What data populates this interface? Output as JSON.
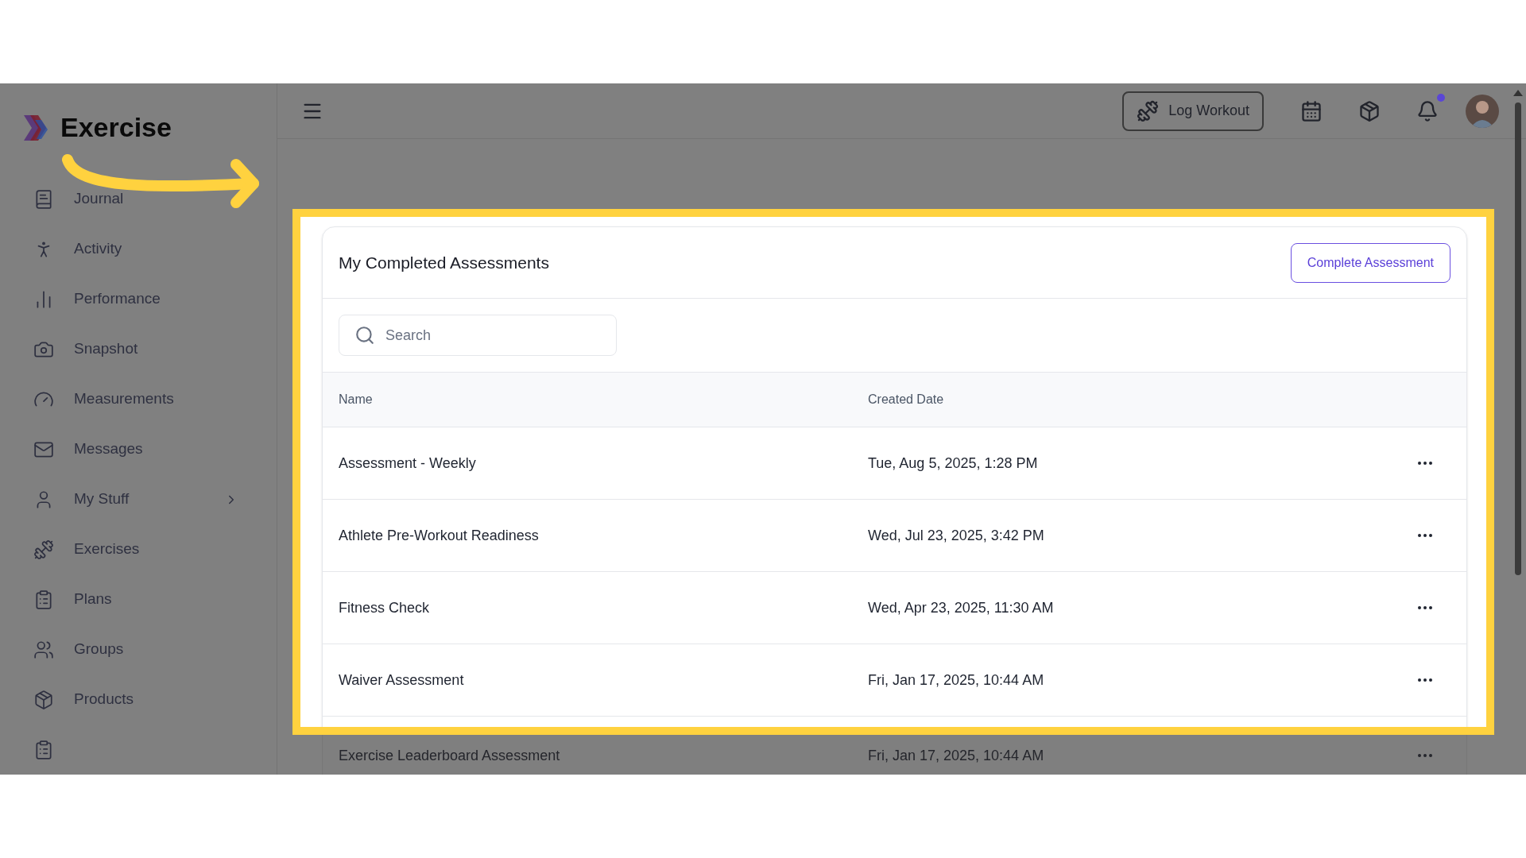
{
  "app": {
    "name": "Exercise"
  },
  "sidebar": {
    "items": [
      {
        "label": "Journal",
        "has_submenu": false
      },
      {
        "label": "Activity",
        "has_submenu": false
      },
      {
        "label": "Performance",
        "has_submenu": false
      },
      {
        "label": "Snapshot",
        "has_submenu": false
      },
      {
        "label": "Measurements",
        "has_submenu": false
      },
      {
        "label": "Messages",
        "has_submenu": false
      },
      {
        "label": "My Stuff",
        "has_submenu": true
      },
      {
        "label": "Exercises",
        "has_submenu": false
      },
      {
        "label": "Plans",
        "has_submenu": false
      },
      {
        "label": "Groups",
        "has_submenu": false
      },
      {
        "label": "Products",
        "has_submenu": false
      }
    ]
  },
  "topbar": {
    "log_workout_button": "Log Workout",
    "notifications_unread": true
  },
  "card": {
    "title": "My Completed Assessments",
    "action_button": "Complete Assessment",
    "search": {
      "placeholder": "Search"
    },
    "table": {
      "columns": [
        "Name",
        "Created Date"
      ],
      "rows": [
        {
          "name": "Assessment - Weekly",
          "created": "Tue, Aug 5, 2025, 1:28 PM",
          "highlighted": true
        },
        {
          "name": "Athlete Pre-Workout Readiness",
          "created": "Wed, Jul 23, 2025, 3:42 PM",
          "highlighted": true
        },
        {
          "name": "Fitness Check",
          "created": "Wed, Apr 23, 2025, 11:30 AM",
          "highlighted": true
        },
        {
          "name": "Waiver Assessment",
          "created": "Fri, Jan 17, 2025, 10:44 AM",
          "highlighted": true
        },
        {
          "name": "Exercise Leaderboard Assessment",
          "created": "Fri, Jan 17, 2025, 10:44 AM",
          "highlighted": false
        }
      ]
    }
  }
}
